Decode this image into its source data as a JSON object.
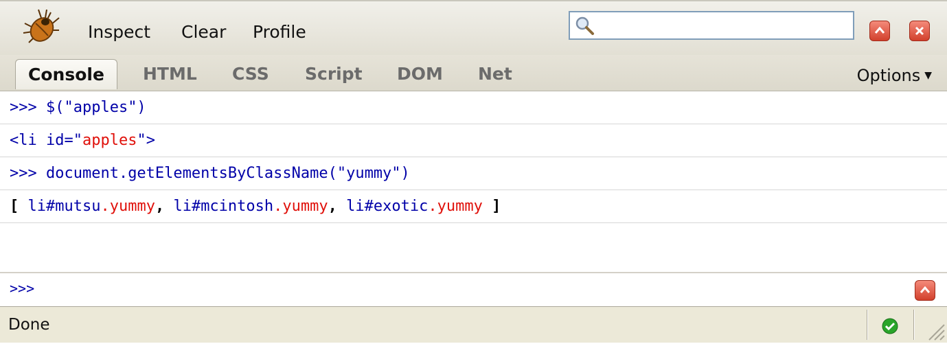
{
  "toolbar": {
    "inspect_label": "Inspect",
    "clear_label": "Clear",
    "profile_label": "Profile",
    "search_placeholder": "",
    "icons": [
      "firebug-icon",
      "search-icon",
      "minimize-icon",
      "close-icon"
    ]
  },
  "tabs": [
    {
      "label": "Console",
      "active": true
    },
    {
      "label": "HTML",
      "active": false
    },
    {
      "label": "CSS",
      "active": false
    },
    {
      "label": "Script",
      "active": false
    },
    {
      "label": "DOM",
      "active": false
    },
    {
      "label": "Net",
      "active": false
    }
  ],
  "options_label": "Options",
  "console": {
    "rows": [
      {
        "prompt": ">>> ",
        "command": "$(\"apples\")"
      },
      {
        "open": "<li id=\"",
        "id_value": "apples",
        "close": "\">"
      },
      {
        "prompt": ">>> ",
        "command": "document.getElementsByClassName(\"yummy\")"
      },
      {
        "open_bracket": "[ ",
        "items": [
          {
            "tag_id": "li#mutsu",
            "dot": ".",
            "class": "yummy",
            "sep": ", "
          },
          {
            "tag_id": "li#mcintosh",
            "dot": ".",
            "class": "yummy",
            "sep": ", "
          },
          {
            "tag_id": "li#exotic",
            "dot": ".",
            "class": "yummy",
            "sep": ""
          }
        ],
        "close_bracket": " ]"
      }
    ]
  },
  "command_line": {
    "prompt": ">>>",
    "value": ""
  },
  "status": {
    "text": "Done"
  },
  "colors": {
    "string": "#e0100a",
    "code": "#0000a8",
    "accent": "#d2402c",
    "ok": "#2aa52a"
  }
}
